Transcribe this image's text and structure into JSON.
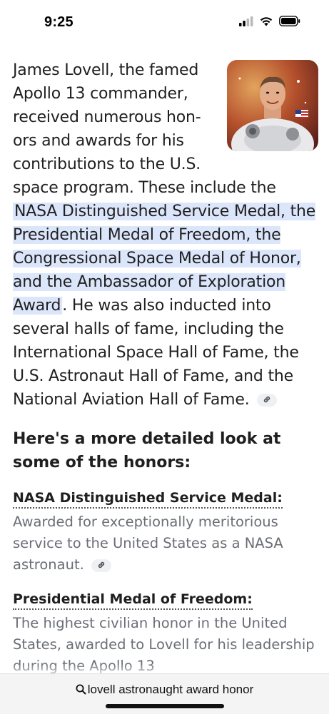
{
  "status_bar": {
    "time": "9:25"
  },
  "article": {
    "intro_before": "James Lovell, the famed Apollo 13 commander, received numerous hon­ors and awards for his contributions to the U.S. space program. These include the ",
    "intro_highlight": "NASA Distinguished Service Medal, the Presidential Medal of Freedom, the Congressional Space Medal of Honor, and the Ambassador of Ex­ploration Award",
    "intro_after": ". He was also induct­ed into several halls of fame, including the International Space Hall of Fame, the U.S. Astronaut Hall of Fame, and the National Aviation Hall of Fame.",
    "image_icon": "astronaut-portrait",
    "link_icon": "link-icon",
    "subheading": "Here's a more detailed look at some of the honors:",
    "honors": [
      {
        "title": "NASA Distinguished Service Medal:",
        "description": "Awarded for exceptionally meritorious service to the United States as a NASA astronaut."
      },
      {
        "title": "Presidential Medal of Freedom:",
        "description": "The highest civilian honor in the United States, awarded to Lovell for his leadership during the Apollo 13"
      }
    ]
  },
  "bottom_bar": {
    "search_icon": "search-icon",
    "query": "lovell astronaught award honor"
  },
  "colors": {
    "highlight": "#dce6fb",
    "body_text": "#1f1f1f",
    "muted_text": "#6a6e75"
  }
}
